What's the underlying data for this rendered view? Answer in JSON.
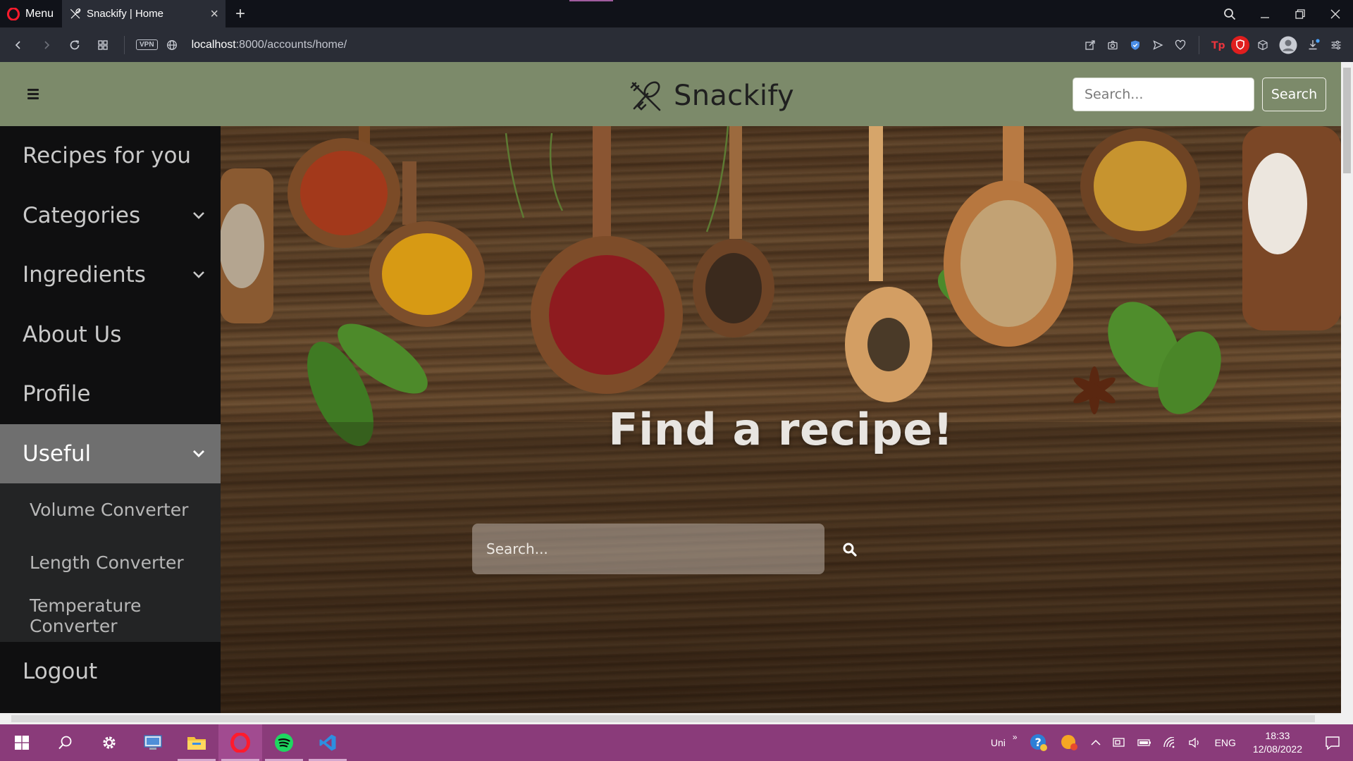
{
  "browser": {
    "menu_label": "Menu",
    "tab_title": "Snackify | Home",
    "url_host": "localhost",
    "url_path": ":8000/accounts/home/",
    "vpn_label": "VPN"
  },
  "navbar": {
    "brand": "Snackify",
    "search_placeholder": "Search...",
    "search_button": "Search"
  },
  "sidebar": {
    "items": [
      {
        "label": "Recipes for you"
      },
      {
        "label": "Categories"
      },
      {
        "label": "Ingredients"
      },
      {
        "label": "About Us"
      },
      {
        "label": "Profile"
      },
      {
        "label": "Useful"
      }
    ],
    "useful_submenu": [
      {
        "label": "Volume Converter"
      },
      {
        "label": "Length Converter"
      },
      {
        "label": "Temperature Converter"
      }
    ],
    "logout": "Logout"
  },
  "hero": {
    "title": "Find a recipe!",
    "search_placeholder": "Search..."
  },
  "taskbar": {
    "tray_text": "Uni",
    "language": "ENG",
    "time": "18:33",
    "date": "12/08/2022"
  },
  "colors": {
    "navbar": "#7c8a6a",
    "sidebar": "#0f0f10",
    "sidebar_active": "#6f6f6f",
    "taskbar": "#8a3b7a"
  }
}
